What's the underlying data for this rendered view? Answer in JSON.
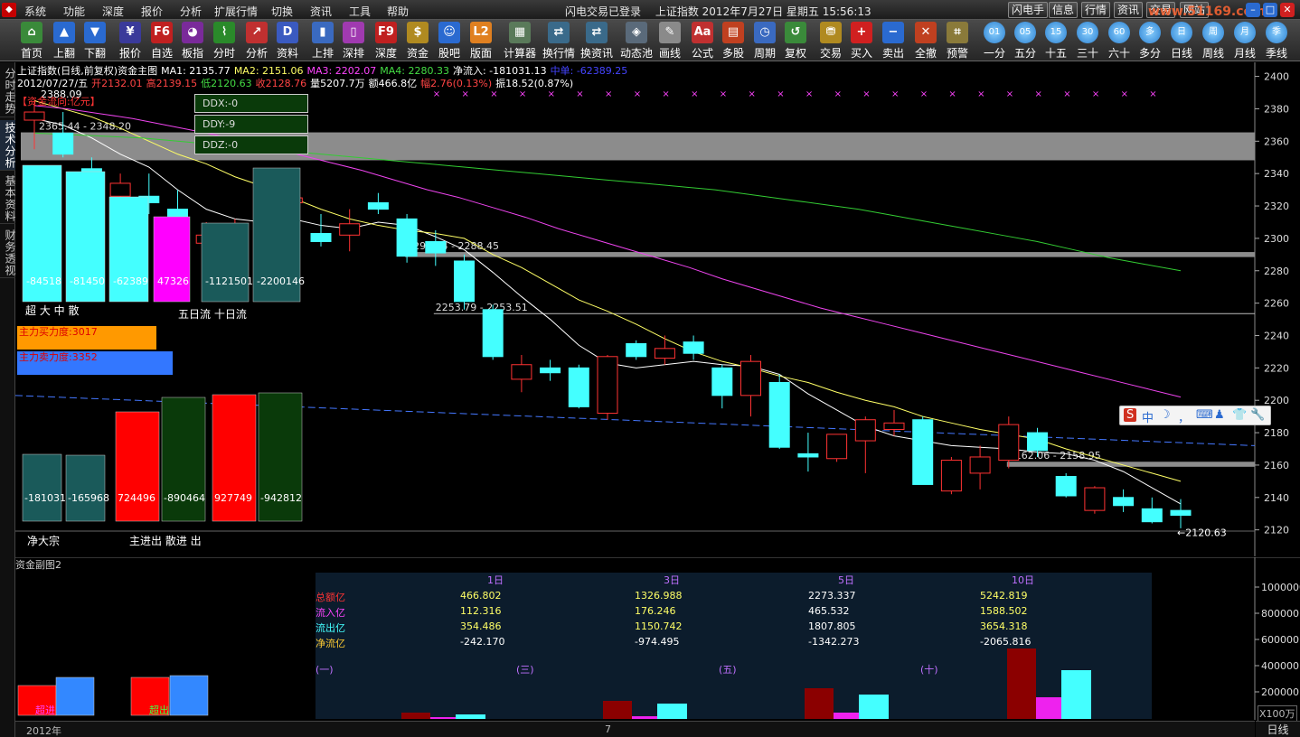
{
  "menubar": {
    "items": [
      "系统",
      "功能",
      "深度",
      "报价",
      "分析",
      "扩展行情",
      "切换",
      "资讯",
      "工具",
      "帮助"
    ],
    "status_left": "闪电交易已登录",
    "status_right": "上证指数 2012年7月27日 星期五 15:56:13",
    "right_buttons": [
      "闪电手",
      "信息",
      "行情",
      "资讯",
      "交易",
      "网站"
    ],
    "watermark": "www.51169.com"
  },
  "toolbar": {
    "buttons": [
      {
        "label": "首页",
        "icon": "home-icon",
        "glyph": "⌂",
        "color": "#3a8a3a"
      },
      {
        "label": "上翻",
        "icon": "up-arrow-icon",
        "glyph": "▲",
        "color": "#2a6ad0"
      },
      {
        "label": "下翻",
        "icon": "down-arrow-icon",
        "glyph": "▼",
        "color": "#2a6ad0"
      },
      {
        "label": "报价",
        "icon": "yen-icon",
        "glyph": "¥",
        "color": "#3a3a9a"
      },
      {
        "label": "自选",
        "icon": "f6-icon",
        "glyph": "F6",
        "color": "#c02020"
      },
      {
        "label": "板指",
        "icon": "pie-icon",
        "glyph": "◕",
        "color": "#7a2a9a"
      },
      {
        "label": "分时",
        "icon": "line-chart-icon",
        "glyph": "⌇",
        "color": "#2a8a2a"
      },
      {
        "label": "分析",
        "icon": "candle-chart-icon",
        "glyph": "↗",
        "color": "#c03030"
      },
      {
        "label": "资料",
        "icon": "document-icon",
        "glyph": "D",
        "color": "#3a5ac0"
      },
      {
        "label": "上排",
        "icon": "bar-chart-icon",
        "glyph": "▮",
        "color": "#3a6ac0"
      },
      {
        "label": "深排",
        "icon": "rank-icon",
        "glyph": "▯",
        "color": "#a03ab0"
      },
      {
        "label": "深度",
        "icon": "f9-icon",
        "glyph": "F9",
        "color": "#c02020"
      },
      {
        "label": "资金",
        "icon": "money-icon",
        "glyph": "$",
        "color": "#b08a20"
      },
      {
        "label": "股吧",
        "icon": "people-icon",
        "glyph": "☺",
        "color": "#2a6ad0"
      },
      {
        "label": "版面",
        "icon": "l2-icon",
        "glyph": "L2",
        "color": "#e08020"
      },
      {
        "label": "计算器",
        "icon": "calculator-icon",
        "glyph": "▦",
        "color": "#5a7a5a"
      },
      {
        "label": "换行情",
        "icon": "switch-quote-icon",
        "glyph": "⇄",
        "color": "#3a6a8a"
      },
      {
        "label": "换资讯",
        "icon": "switch-news-icon",
        "glyph": "⇄",
        "color": "#3a6a8a"
      },
      {
        "label": "动态池",
        "icon": "pool-icon",
        "glyph": "◈",
        "color": "#5a6a7a"
      },
      {
        "label": "画线",
        "icon": "pen-icon",
        "glyph": "✎",
        "color": "#8a8a8a"
      },
      {
        "label": "公式",
        "icon": "formula-icon",
        "glyph": "Aa",
        "color": "#c03030"
      },
      {
        "label": "多股",
        "icon": "multi-stock-icon",
        "glyph": "▤",
        "color": "#c04020"
      },
      {
        "label": "周期",
        "icon": "period-icon",
        "glyph": "◷",
        "color": "#3a6ac0"
      },
      {
        "label": "复权",
        "icon": "restore-icon",
        "glyph": "↺",
        "color": "#3a8a3a"
      },
      {
        "label": "交易",
        "icon": "trade-icon",
        "glyph": "⛃",
        "color": "#b08a20"
      },
      {
        "label": "买入",
        "icon": "buy-icon",
        "glyph": "+",
        "color": "#d02020"
      },
      {
        "label": "卖出",
        "icon": "sell-icon",
        "glyph": "−",
        "color": "#2a6ad0"
      },
      {
        "label": "全撤",
        "icon": "cancel-all-icon",
        "glyph": "✕",
        "color": "#c04020"
      },
      {
        "label": "预警",
        "icon": "alert-icon",
        "glyph": "⌗",
        "color": "#8a7a3a"
      }
    ],
    "periods": [
      {
        "label": "一分",
        "tag": "01"
      },
      {
        "label": "五分",
        "tag": "05"
      },
      {
        "label": "十五",
        "tag": "15"
      },
      {
        "label": "三十",
        "tag": "30"
      },
      {
        "label": "六十",
        "tag": "60"
      },
      {
        "label": "多分",
        "tag": "多"
      },
      {
        "label": "日线",
        "tag": "日"
      },
      {
        "label": "周线",
        "tag": "周"
      },
      {
        "label": "月线",
        "tag": "月"
      },
      {
        "label": "季线",
        "tag": "季"
      }
    ]
  },
  "left_tabs": [
    {
      "label": "分时走势",
      "active": false
    },
    {
      "label": "技术分析",
      "active": true
    },
    {
      "label": "基本资料",
      "active": false
    },
    {
      "label": "财务透视",
      "active": false
    }
  ],
  "chart_header": {
    "line1": [
      {
        "text": "上证指数(日线,前复权)资金主图",
        "color": "#ffffff"
      },
      {
        "text": "MA1: 2135.77",
        "color": "#ffffff"
      },
      {
        "text": "MA2: 2151.06",
        "color": "#ffff66"
      },
      {
        "text": "MA3: 2202.07",
        "color": "#ff44ff"
      },
      {
        "text": "MA4: 2280.33",
        "color": "#44dd44"
      },
      {
        "text": "净流入: -181031.13",
        "color": "#ffffff"
      },
      {
        "text": "中单: -62389.25",
        "color": "#4444ff"
      }
    ],
    "line2": [
      {
        "text": "2012/07/27/五",
        "color": "#ffffff"
      },
      {
        "text": "开2132.01",
        "color": "#ff4444"
      },
      {
        "text": "高2139.15",
        "color": "#ff4444"
      },
      {
        "text": "低2120.63",
        "color": "#44dd44"
      },
      {
        "text": "收2128.76",
        "color": "#ff4444"
      },
      {
        "text": "量5207.7万",
        "color": "#ffffff"
      },
      {
        "text": "额466.8亿",
        "color": "#ffffff"
      },
      {
        "text": "幅2.76(0.13%)",
        "color": "#ff4444"
      },
      {
        "text": "振18.52(0.87%)",
        "color": "#ffffff"
      }
    ],
    "unit_note": "【资金流向:亿元】"
  },
  "ddx": [
    {
      "label": "DDX:-0"
    },
    {
      "label": "DDY:-9"
    },
    {
      "label": "DDZ:-0"
    }
  ],
  "flow_bars_top": {
    "values": [
      -84518,
      -81450,
      -62389,
      47326,
      -1121501,
      -2200146
    ],
    "labels": [
      "-84518",
      "-81450",
      "-62389",
      "47326",
      "-1121501",
      "-2200146"
    ],
    "caption_left": "超 大 中 散",
    "caption_right": "五日流  十日流"
  },
  "power": {
    "buy": {
      "label": "主力买力度:3017",
      "value": 3017,
      "color": "#ff9900"
    },
    "sell": {
      "label": "主力卖力度:3352",
      "value": 3352,
      "color": "#3377ff"
    }
  },
  "flow_bars_bottom": {
    "values": [
      -181031,
      -165968,
      724496,
      -890464,
      927749,
      -942812
    ],
    "labels": [
      "-181031",
      "-165968",
      "724496",
      "-890464",
      "927749",
      "-942812"
    ],
    "caption_left": "净大宗",
    "caption_right": "主进出  散进 出"
  },
  "chart_data": {
    "type": "candlestick",
    "title": "上证指数(日线,前复权)资金主图",
    "ylim": [
      2112,
      2402
    ],
    "y_ticks": [
      2400,
      2380,
      2360,
      2340,
      2320,
      2300,
      2280,
      2260,
      2240,
      2220,
      2200,
      2180,
      2160,
      2140,
      2120
    ],
    "candles": [
      {
        "o": 2373,
        "h": 2385,
        "l": 2355,
        "c": 2378
      },
      {
        "o": 2365,
        "h": 2378,
        "l": 2350,
        "c": 2352
      },
      {
        "o": 2343,
        "h": 2350,
        "l": 2320,
        "c": 2327
      },
      {
        "o": 2326,
        "h": 2340,
        "l": 2318,
        "c": 2334
      },
      {
        "o": 2326,
        "h": 2340,
        "l": 2315,
        "c": 2322
      },
      {
        "o": 2318,
        "h": 2330,
        "l": 2305,
        "c": 2310
      },
      {
        "o": 2297,
        "h": 2310,
        "l": 2282,
        "c": 2302
      },
      {
        "o": 2300,
        "h": 2312,
        "l": 2285,
        "c": 2305
      },
      {
        "o": 2315,
        "h": 2335,
        "l": 2300,
        "c": 2310
      },
      {
        "o": 2322,
        "h": 2332,
        "l": 2315,
        "c": 2325
      },
      {
        "o": 2303,
        "h": 2315,
        "l": 2295,
        "c": 2298
      },
      {
        "o": 2302,
        "h": 2318,
        "l": 2292,
        "c": 2309
      },
      {
        "o": 2322,
        "h": 2328,
        "l": 2315,
        "c": 2318
      },
      {
        "o": 2312,
        "h": 2315,
        "l": 2285,
        "c": 2289
      },
      {
        "o": 2298,
        "h": 2305,
        "l": 2283,
        "c": 2291
      },
      {
        "o": 2286,
        "h": 2290,
        "l": 2256,
        "c": 2261
      },
      {
        "o": 2256,
        "h": 2259,
        "l": 2225,
        "c": 2227
      },
      {
        "o": 2213,
        "h": 2228,
        "l": 2205,
        "c": 2222
      },
      {
        "o": 2220,
        "h": 2225,
        "l": 2212,
        "c": 2217
      },
      {
        "o": 2220,
        "h": 2222,
        "l": 2195,
        "c": 2196
      },
      {
        "o": 2192,
        "h": 2228,
        "l": 2188,
        "c": 2227
      },
      {
        "o": 2235,
        "h": 2237,
        "l": 2225,
        "c": 2227
      },
      {
        "o": 2226,
        "h": 2240,
        "l": 2222,
        "c": 2232
      },
      {
        "o": 2236,
        "h": 2240,
        "l": 2225,
        "c": 2229
      },
      {
        "o": 2220,
        "h": 2222,
        "l": 2195,
        "c": 2203
      },
      {
        "o": 2203,
        "h": 2228,
        "l": 2190,
        "c": 2224
      },
      {
        "o": 2211,
        "h": 2216,
        "l": 2170,
        "c": 2171
      },
      {
        "o": 2167,
        "h": 2180,
        "l": 2156,
        "c": 2165
      },
      {
        "o": 2164,
        "h": 2178,
        "l": 2162,
        "c": 2179
      },
      {
        "o": 2175,
        "h": 2190,
        "l": 2155,
        "c": 2188
      },
      {
        "o": 2182,
        "h": 2194,
        "l": 2178,
        "c": 2186
      },
      {
        "o": 2188,
        "h": 2190,
        "l": 2148,
        "c": 2148
      },
      {
        "o": 2144,
        "h": 2165,
        "l": 2142,
        "c": 2163
      },
      {
        "o": 2155,
        "h": 2172,
        "l": 2145,
        "c": 2165
      },
      {
        "o": 2163,
        "h": 2190,
        "l": 2158,
        "c": 2185
      },
      {
        "o": 2180,
        "h": 2183,
        "l": 2165,
        "c": 2169
      },
      {
        "o": 2153,
        "h": 2155,
        "l": 2140,
        "c": 2141
      },
      {
        "o": 2132,
        "h": 2147,
        "l": 2130,
        "c": 2146
      },
      {
        "o": 2140,
        "h": 2145,
        "l": 2131,
        "c": 2135
      },
      {
        "o": 2133,
        "h": 2140,
        "l": 2124,
        "c": 2125
      },
      {
        "o": 2132,
        "h": 2139,
        "l": 2121,
        "c": 2129
      }
    ],
    "ma_lines": [
      {
        "name": "MA1",
        "color": "#ffffff",
        "values": [
          2374,
          2370,
          2362,
          2352,
          2344,
          2330,
          2318,
          2312,
          2310,
          2312,
          2308,
          2306,
          2310,
          2308,
          2301,
          2293,
          2279,
          2264,
          2250,
          2234,
          2223,
          2220,
          2222,
          2224,
          2222,
          2221,
          2216,
          2204,
          2194,
          2184,
          2178,
          2175,
          2172,
          2171,
          2170,
          2168,
          2167,
          2163,
          2156,
          2146,
          2136
        ]
      },
      {
        "name": "MA2",
        "color": "#ffff66",
        "values": [
          2385,
          2380,
          2375,
          2368,
          2360,
          2352,
          2346,
          2338,
          2332,
          2325,
          2318,
          2312,
          2308,
          2305,
          2303,
          2300,
          2290,
          2282,
          2272,
          2262,
          2255,
          2247,
          2238,
          2230,
          2224,
          2220,
          2215,
          2211,
          2205,
          2200,
          2196,
          2190,
          2186,
          2182,
          2179,
          2176,
          2170,
          2165,
          2160,
          2155,
          2150
        ]
      },
      {
        "name": "MA3",
        "color": "#ee44ee",
        "values": [
          2382,
          2380,
          2377,
          2374,
          2370,
          2366,
          2362,
          2357,
          2352,
          2347,
          2342,
          2336,
          2330,
          2325,
          2319,
          2313,
          2306,
          2300,
          2294,
          2288,
          2282,
          2275,
          2269,
          2263,
          2257,
          2252,
          2247,
          2242,
          2237,
          2232,
          2227,
          2222,
          2217,
          2212,
          2207,
          2202
        ]
      },
      {
        "name": "MA4",
        "color": "#33cc33",
        "values": [
          2365,
          2364,
          2363,
          2362,
          2360,
          2358,
          2356,
          2354,
          2352,
          2350,
          2348,
          2346,
          2344,
          2342,
          2340,
          2338,
          2336,
          2334,
          2332,
          2330,
          2327,
          2324,
          2321,
          2318,
          2314,
          2310,
          2306,
          2302,
          2298,
          2293,
          2288,
          2284,
          2280
        ]
      }
    ],
    "trendline_dashed": {
      "from": 2203,
      "to": 2172,
      "color": "#4477ff"
    },
    "zones": [
      {
        "label": "2365.44 - 2348.20",
        "high": 2365.44,
        "low": 2348.2,
        "x_start_index": 0,
        "label_index": 0
      },
      {
        "label": "2291.54 - 2288.45",
        "high": 2291.54,
        "low": 2288.45,
        "x_start_index": 13,
        "label_index": 13
      },
      {
        "label": "2253.79 - 2253.51",
        "high": 2253.79,
        "low": 2253.51,
        "x_start_index": 14,
        "label_index": 14
      },
      {
        "label": "2162.06 - 2158.95",
        "high": 2162.06,
        "low": 2158.95,
        "x_start_index": 34,
        "label_index": 34
      }
    ],
    "high_marker": {
      "label": "2388.09",
      "value": 2388.09
    },
    "low_marker": {
      "label": "←2120.63",
      "value": 2120.63
    },
    "x_markers_row": "×"
  },
  "sub_chart": {
    "title": "资金副图2",
    "y_ticks": [
      "1000000",
      "800000",
      "600000",
      "400000",
      "200000"
    ],
    "unit": "X100万",
    "left_bar_labels": [
      "超进",
      "超出"
    ],
    "left_bars": [
      {
        "color": "#ff0000",
        "value": 33
      },
      {
        "color": "#3388ff",
        "value": 42
      },
      {
        "color": "#ff0000",
        "value": 42
      },
      {
        "color": "#3388ff",
        "value": 44
      }
    ],
    "panel": {
      "headers": [
        "1日",
        "3日",
        "5日",
        "10日"
      ],
      "rows": [
        {
          "label": "总额亿",
          "color": "#ff3333",
          "values": [
            "466.802",
            "1326.988",
            "2273.337",
            "5242.819"
          ]
        },
        {
          "label": "流入亿",
          "color": "#ff44ff",
          "values": [
            "112.316",
            "176.246",
            "465.532",
            "1588.502"
          ]
        },
        {
          "label": "流出亿",
          "color": "#44ffff",
          "values": [
            "354.486",
            "1150.742",
            "1807.805",
            "3654.318"
          ]
        },
        {
          "label": "净流亿",
          "color": "#ffcc33",
          "values": [
            "-242.170",
            "-974.495",
            "-1342.273",
            "-2065.816"
          ]
        }
      ],
      "groups": [
        "(一)",
        "(三)",
        "(五)",
        "(十)"
      ],
      "bars": [
        {
          "total": 466.802,
          "in": 112.316,
          "out": 354.486
        },
        {
          "total": 1326.988,
          "in": 176.246,
          "out": 1150.742
        },
        {
          "total": 2273.337,
          "in": 465.532,
          "out": 1807.805
        },
        {
          "total": 5242.819,
          "in": 1588.502,
          "out": 3654.318
        }
      ]
    }
  },
  "bottom_axis": {
    "labels": [
      "2012年",
      "7"
    ],
    "period": "日线"
  },
  "ime": {
    "glyphs": [
      "S",
      "中",
      "☽",
      "，",
      "⌨",
      "♟",
      "👕",
      "🔧"
    ]
  }
}
